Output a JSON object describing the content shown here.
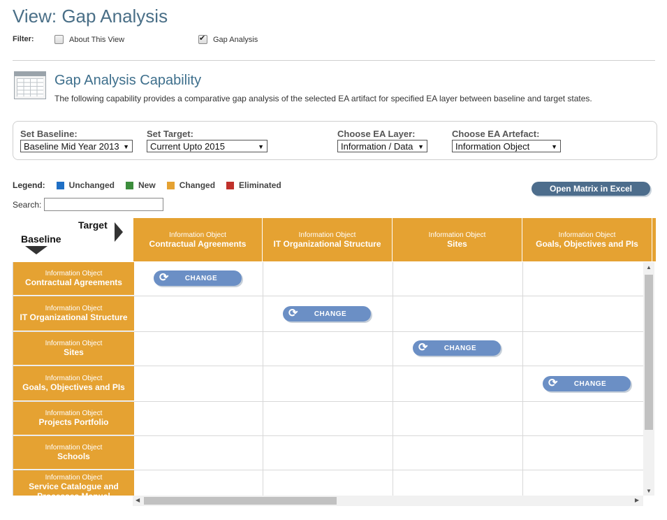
{
  "page_title": "View: Gap Analysis",
  "filter": {
    "label": "Filter:",
    "options": [
      {
        "label": "About This View",
        "checked": false
      },
      {
        "label": "Gap Analysis",
        "checked": true
      }
    ]
  },
  "capability": {
    "title": "Gap Analysis Capability",
    "description": "The following capability provides a comparative gap analysis of the selected EA artifact for specified EA layer between baseline and target states."
  },
  "selectors": {
    "baseline": {
      "label": "Set Baseline:",
      "value": "Baseline Mid Year 2013"
    },
    "target": {
      "label": "Set Target:",
      "value": "Current Upto 2015"
    },
    "layer": {
      "label": "Choose EA Layer:",
      "value": "Information / Data"
    },
    "artefact": {
      "label": "Choose EA Artefact:",
      "value": "Information Object"
    }
  },
  "legend": {
    "label": "Legend:",
    "items": [
      {
        "label": "Unchanged",
        "color": "#1f6fc5"
      },
      {
        "label": "New",
        "color": "#3c8d3c"
      },
      {
        "label": "Changed",
        "color": "#e5a232"
      },
      {
        "label": "Eliminated",
        "color": "#c0312b"
      }
    ]
  },
  "excel_button": "Open Matrix in Excel",
  "search": {
    "label": "Search:",
    "value": ""
  },
  "matrix": {
    "target_label": "Target",
    "baseline_label": "Baseline",
    "columns": [
      {
        "type": "Information Object",
        "name": "Contractual Agreements"
      },
      {
        "type": "Information Object",
        "name": "IT Organizational Structure"
      },
      {
        "type": "Information Object",
        "name": "Sites"
      },
      {
        "type": "Information Object",
        "name": "Goals, Objectives and PIs"
      }
    ],
    "rows": [
      {
        "type": "Information Object",
        "name": "Contractual Agreements"
      },
      {
        "type": "Information Object",
        "name": "IT Organizational Structure"
      },
      {
        "type": "Information Object",
        "name": "Sites"
      },
      {
        "type": "Information Object",
        "name": "Goals, Objectives and PIs"
      },
      {
        "type": "Information Object",
        "name": "Projects Portfolio"
      },
      {
        "type": "Information Object",
        "name": "Schools"
      },
      {
        "type": "Information Object",
        "name": "Service Catalogue and Processes Manual"
      }
    ],
    "change_label": "CHANGE"
  },
  "icons": {
    "change": "refresh-icon",
    "dropdown": "triangle-down-icon",
    "scroll_up": "scroll-up-icon"
  }
}
